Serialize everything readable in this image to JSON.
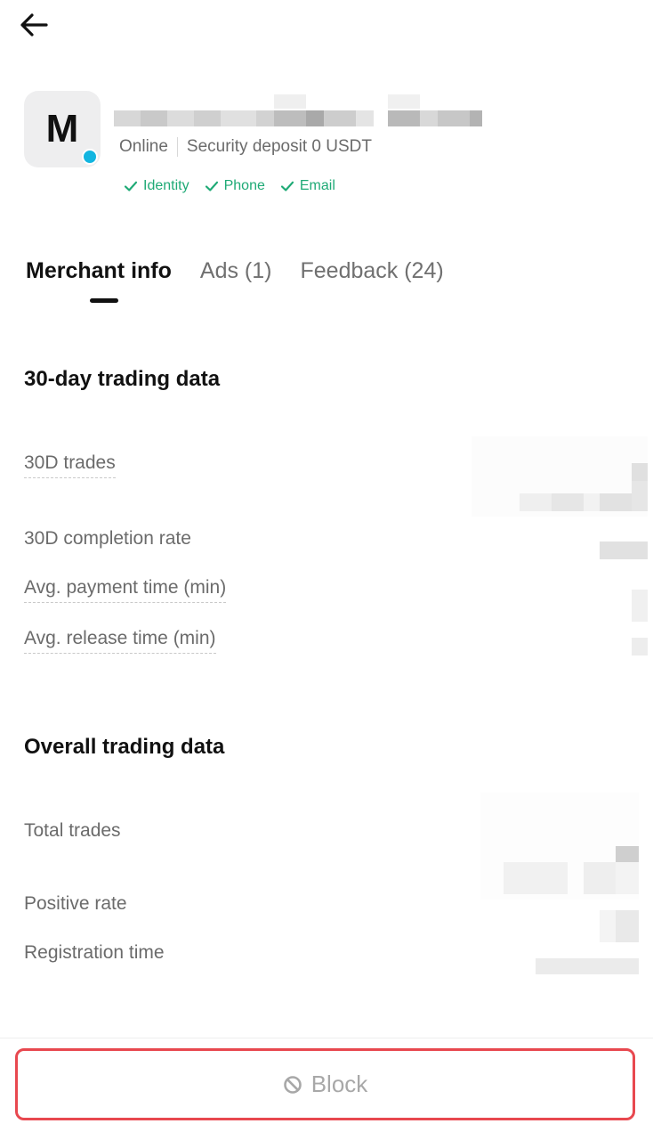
{
  "header": {
    "back_icon": "arrow-left-icon"
  },
  "merchant": {
    "avatar_letter": "M",
    "status": "Online",
    "security_deposit": "Security deposit 0 USDT",
    "verifications": [
      "Identity",
      "Phone",
      "Email"
    ],
    "online_color": "#12b5e0",
    "verify_color": "#1faa76"
  },
  "tabs": [
    {
      "label": "Merchant info",
      "active": true
    },
    {
      "label": "Ads (1)",
      "active": false
    },
    {
      "label": "Feedback (24)",
      "active": false
    }
  ],
  "thirty_day": {
    "title": "30-day trading data",
    "rows": [
      {
        "label": "30D trades"
      },
      {
        "label": "30D completion rate"
      },
      {
        "label": "Avg. payment time (min)"
      },
      {
        "label": "Avg. release time (min)"
      }
    ]
  },
  "overall": {
    "title": "Overall trading data",
    "rows": [
      {
        "label": "Total trades"
      },
      {
        "label": "Positive rate"
      },
      {
        "label": "Registration time"
      }
    ]
  },
  "footer": {
    "block_label": "Block",
    "block_icon": "block-icon",
    "highlight_color": "#e8484f"
  }
}
